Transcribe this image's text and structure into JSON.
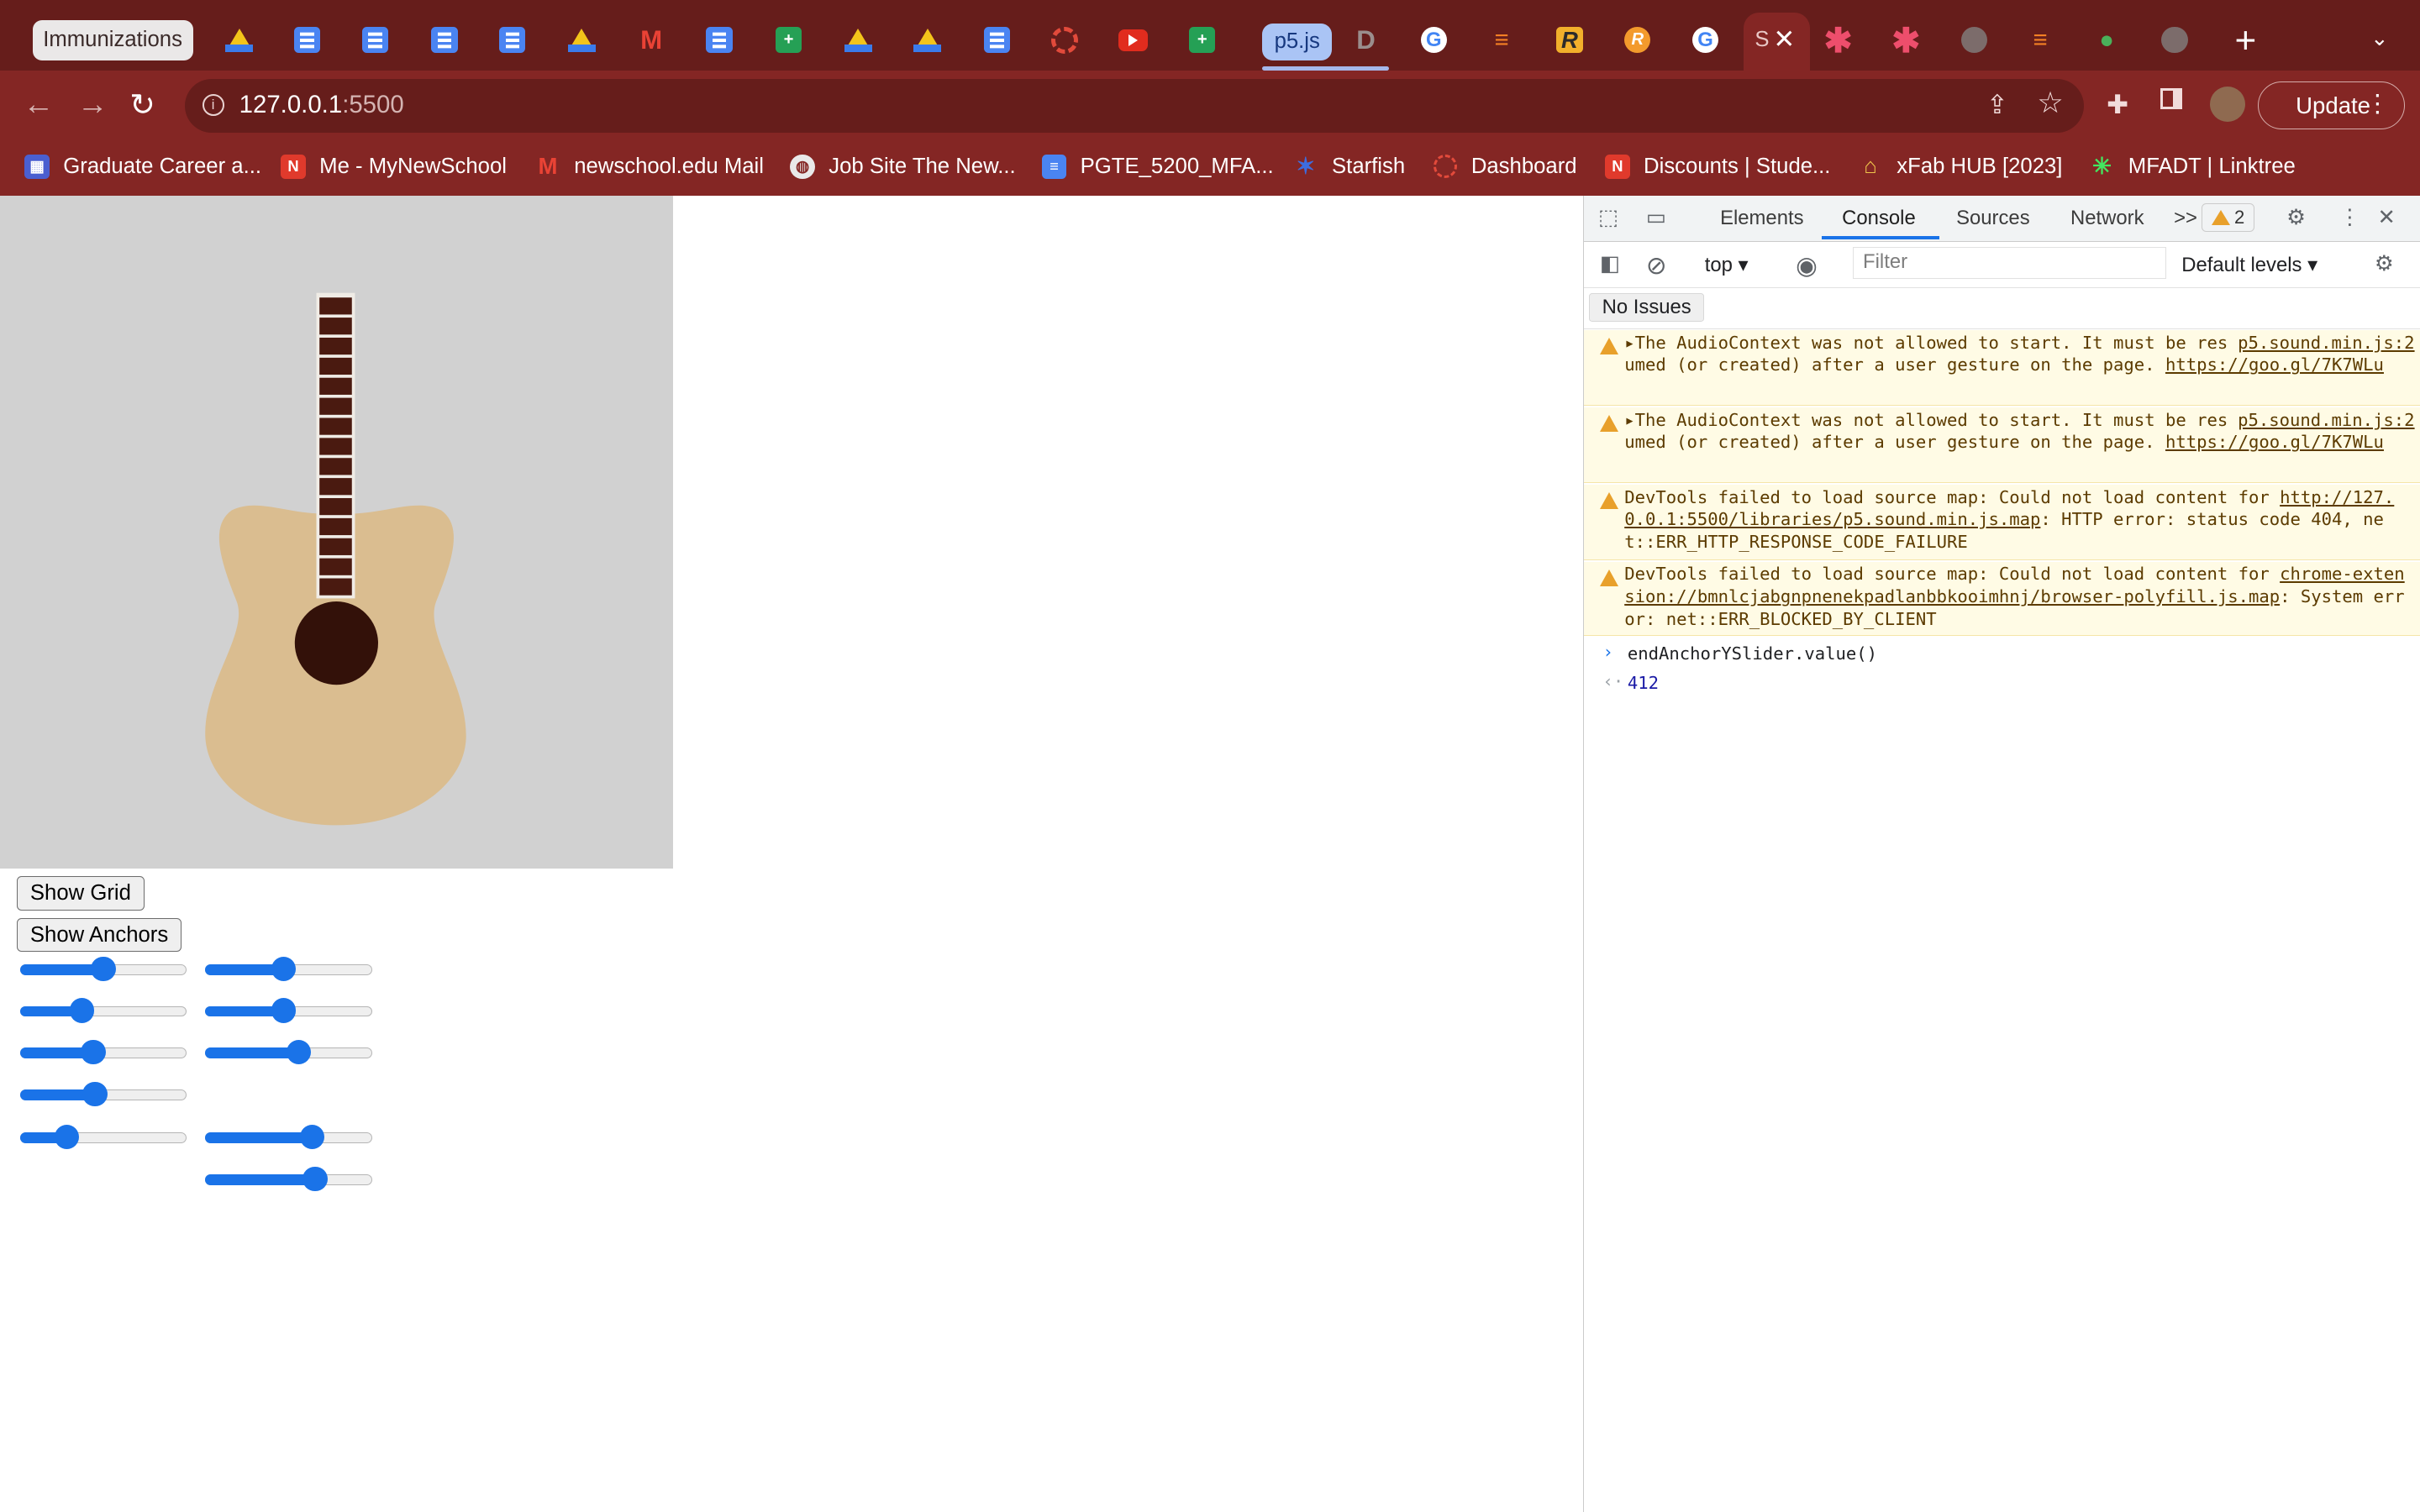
{
  "browser": {
    "tabs": {
      "first_title": "Immunizations",
      "p5_label": "p5.js",
      "active_initial": "S"
    },
    "url_host": "127.0.0.1",
    "url_port": ":5500",
    "update_label": "Update",
    "bookmarks": [
      {
        "label": "Graduate Career a..."
      },
      {
        "label": "Me - MyNewSchool"
      },
      {
        "label": "newschool.edu Mail"
      },
      {
        "label": "Job Site The New..."
      },
      {
        "label": "PGTE_5200_MFA..."
      },
      {
        "label": "Starfish"
      },
      {
        "label": "Dashboard"
      },
      {
        "label": "Discounts | Stude..."
      },
      {
        "label": "xFab HUB [2023]"
      },
      {
        "label": "MFADT | Linktree"
      }
    ]
  },
  "page": {
    "show_grid_label": "Show Grid",
    "show_anchors_label": "Show Anchors",
    "sliders_left": [
      0.5,
      0.37,
      0.44,
      0.45,
      0.28
    ],
    "sliders_right": [
      0.47,
      0.47,
      0.56,
      0.64,
      0.66
    ]
  },
  "devtools": {
    "tabs": {
      "elements": "Elements",
      "console": "Console",
      "sources": "Sources",
      "network": "Network",
      "more": ">>"
    },
    "warning_count": "2",
    "context": "top",
    "filter_placeholder": "Filter",
    "levels": "Default levels",
    "no_issues": "No Issues",
    "messages": [
      {
        "text": "The AudioContext was not allowed to start. It must be resumed (or created) after a user gesture on the page.",
        "link": "https://goo.gl/7K7WLu",
        "source": "p5.sound.min.js:2"
      },
      {
        "text": "The AudioContext was not allowed to start. It must be resumed (or created) after a user gesture on the page.",
        "link": "https://goo.gl/7K7WLu",
        "source": "p5.sound.min.js:2"
      },
      {
        "text_pre": "DevTools failed to load source map: Could not load content for ",
        "link": "http://127.0.0.1:5500/libraries/p5.sound.min.js.map",
        "text_post": ": HTTP error: status code 404, net::ERR_HTTP_RESPONSE_CODE_FAILURE"
      },
      {
        "text_pre": "DevTools failed to load source map: Could not load content for ",
        "link": "chrome-extension://bmnlcjabgnpnenekpadlanbbkooimhnj/browser-polyfill.js.map",
        "text_post": ": System error: net::ERR_BLOCKED_BY_CLIENT"
      }
    ],
    "input": "endAnchorYSlider.value()",
    "output": "412"
  }
}
